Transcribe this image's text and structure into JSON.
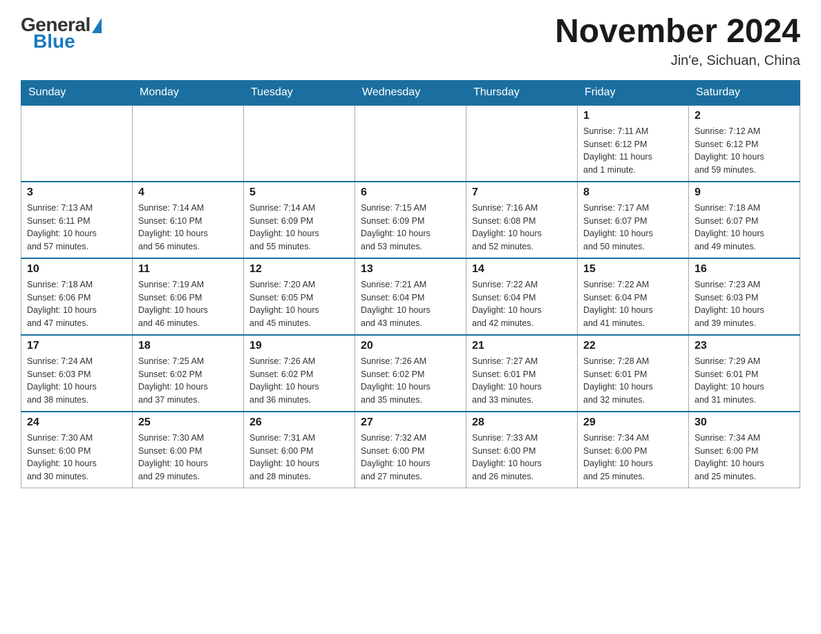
{
  "logo": {
    "general": "General",
    "blue": "Blue"
  },
  "title": "November 2024",
  "location": "Jin'e, Sichuan, China",
  "weekdays": [
    "Sunday",
    "Monday",
    "Tuesday",
    "Wednesday",
    "Thursday",
    "Friday",
    "Saturday"
  ],
  "weeks": [
    [
      {
        "day": "",
        "info": ""
      },
      {
        "day": "",
        "info": ""
      },
      {
        "day": "",
        "info": ""
      },
      {
        "day": "",
        "info": ""
      },
      {
        "day": "",
        "info": ""
      },
      {
        "day": "1",
        "info": "Sunrise: 7:11 AM\nSunset: 6:12 PM\nDaylight: 11 hours\nand 1 minute."
      },
      {
        "day": "2",
        "info": "Sunrise: 7:12 AM\nSunset: 6:12 PM\nDaylight: 10 hours\nand 59 minutes."
      }
    ],
    [
      {
        "day": "3",
        "info": "Sunrise: 7:13 AM\nSunset: 6:11 PM\nDaylight: 10 hours\nand 57 minutes."
      },
      {
        "day": "4",
        "info": "Sunrise: 7:14 AM\nSunset: 6:10 PM\nDaylight: 10 hours\nand 56 minutes."
      },
      {
        "day": "5",
        "info": "Sunrise: 7:14 AM\nSunset: 6:09 PM\nDaylight: 10 hours\nand 55 minutes."
      },
      {
        "day": "6",
        "info": "Sunrise: 7:15 AM\nSunset: 6:09 PM\nDaylight: 10 hours\nand 53 minutes."
      },
      {
        "day": "7",
        "info": "Sunrise: 7:16 AM\nSunset: 6:08 PM\nDaylight: 10 hours\nand 52 minutes."
      },
      {
        "day": "8",
        "info": "Sunrise: 7:17 AM\nSunset: 6:07 PM\nDaylight: 10 hours\nand 50 minutes."
      },
      {
        "day": "9",
        "info": "Sunrise: 7:18 AM\nSunset: 6:07 PM\nDaylight: 10 hours\nand 49 minutes."
      }
    ],
    [
      {
        "day": "10",
        "info": "Sunrise: 7:18 AM\nSunset: 6:06 PM\nDaylight: 10 hours\nand 47 minutes."
      },
      {
        "day": "11",
        "info": "Sunrise: 7:19 AM\nSunset: 6:06 PM\nDaylight: 10 hours\nand 46 minutes."
      },
      {
        "day": "12",
        "info": "Sunrise: 7:20 AM\nSunset: 6:05 PM\nDaylight: 10 hours\nand 45 minutes."
      },
      {
        "day": "13",
        "info": "Sunrise: 7:21 AM\nSunset: 6:04 PM\nDaylight: 10 hours\nand 43 minutes."
      },
      {
        "day": "14",
        "info": "Sunrise: 7:22 AM\nSunset: 6:04 PM\nDaylight: 10 hours\nand 42 minutes."
      },
      {
        "day": "15",
        "info": "Sunrise: 7:22 AM\nSunset: 6:04 PM\nDaylight: 10 hours\nand 41 minutes."
      },
      {
        "day": "16",
        "info": "Sunrise: 7:23 AM\nSunset: 6:03 PM\nDaylight: 10 hours\nand 39 minutes."
      }
    ],
    [
      {
        "day": "17",
        "info": "Sunrise: 7:24 AM\nSunset: 6:03 PM\nDaylight: 10 hours\nand 38 minutes."
      },
      {
        "day": "18",
        "info": "Sunrise: 7:25 AM\nSunset: 6:02 PM\nDaylight: 10 hours\nand 37 minutes."
      },
      {
        "day": "19",
        "info": "Sunrise: 7:26 AM\nSunset: 6:02 PM\nDaylight: 10 hours\nand 36 minutes."
      },
      {
        "day": "20",
        "info": "Sunrise: 7:26 AM\nSunset: 6:02 PM\nDaylight: 10 hours\nand 35 minutes."
      },
      {
        "day": "21",
        "info": "Sunrise: 7:27 AM\nSunset: 6:01 PM\nDaylight: 10 hours\nand 33 minutes."
      },
      {
        "day": "22",
        "info": "Sunrise: 7:28 AM\nSunset: 6:01 PM\nDaylight: 10 hours\nand 32 minutes."
      },
      {
        "day": "23",
        "info": "Sunrise: 7:29 AM\nSunset: 6:01 PM\nDaylight: 10 hours\nand 31 minutes."
      }
    ],
    [
      {
        "day": "24",
        "info": "Sunrise: 7:30 AM\nSunset: 6:00 PM\nDaylight: 10 hours\nand 30 minutes."
      },
      {
        "day": "25",
        "info": "Sunrise: 7:30 AM\nSunset: 6:00 PM\nDaylight: 10 hours\nand 29 minutes."
      },
      {
        "day": "26",
        "info": "Sunrise: 7:31 AM\nSunset: 6:00 PM\nDaylight: 10 hours\nand 28 minutes."
      },
      {
        "day": "27",
        "info": "Sunrise: 7:32 AM\nSunset: 6:00 PM\nDaylight: 10 hours\nand 27 minutes."
      },
      {
        "day": "28",
        "info": "Sunrise: 7:33 AM\nSunset: 6:00 PM\nDaylight: 10 hours\nand 26 minutes."
      },
      {
        "day": "29",
        "info": "Sunrise: 7:34 AM\nSunset: 6:00 PM\nDaylight: 10 hours\nand 25 minutes."
      },
      {
        "day": "30",
        "info": "Sunrise: 7:34 AM\nSunset: 6:00 PM\nDaylight: 10 hours\nand 25 minutes."
      }
    ]
  ]
}
